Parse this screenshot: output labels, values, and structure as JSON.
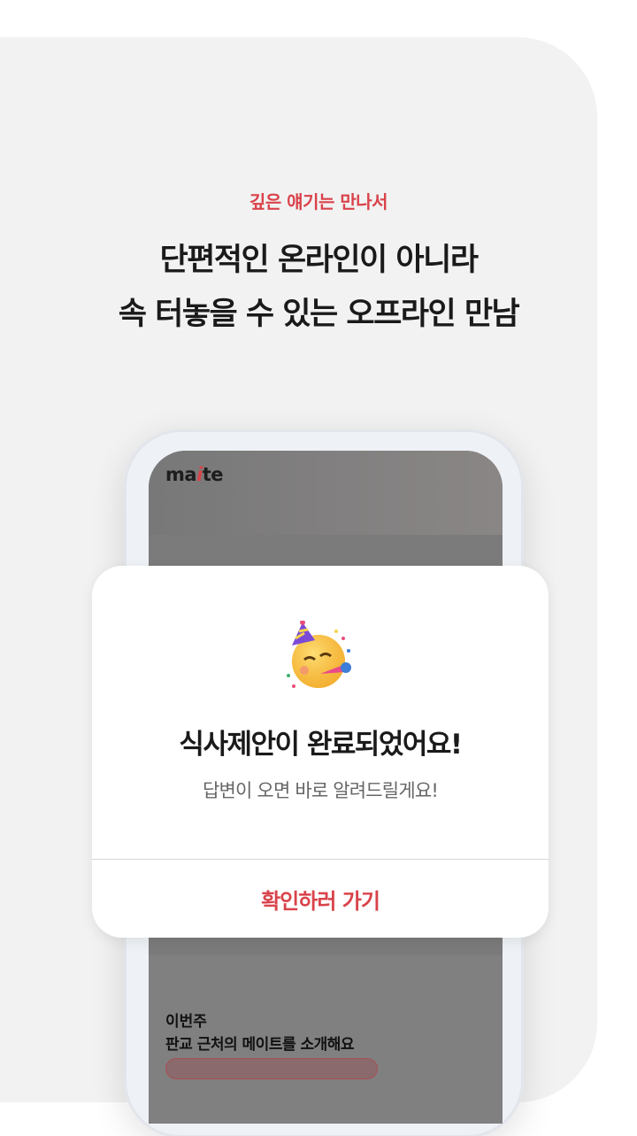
{
  "intro": {
    "eyebrow": "깊은 얘기는 만나서",
    "headline_line1": "단편적인 온라인이 아니라",
    "headline_line2": "속 터놓을 수 있는 오프라인 만남"
  },
  "app": {
    "logo_prefix": "ma",
    "logo_accent": "i",
    "logo_suffix": "te",
    "week_label": "이번주",
    "week_title": "판교 근처의 메이트를 소개해요"
  },
  "dialog": {
    "emoji_icon": "partying-face-icon",
    "title": "식사제안이 완료되었어요!",
    "subtitle": "답변이 오면 바로 알려드릴게요!",
    "confirm_label": "확인하러 가기"
  },
  "colors": {
    "accent": "#d9434b",
    "panel_bg": "#f2f2f2",
    "text_dark": "#1a1a1a",
    "text_muted": "#666666"
  }
}
